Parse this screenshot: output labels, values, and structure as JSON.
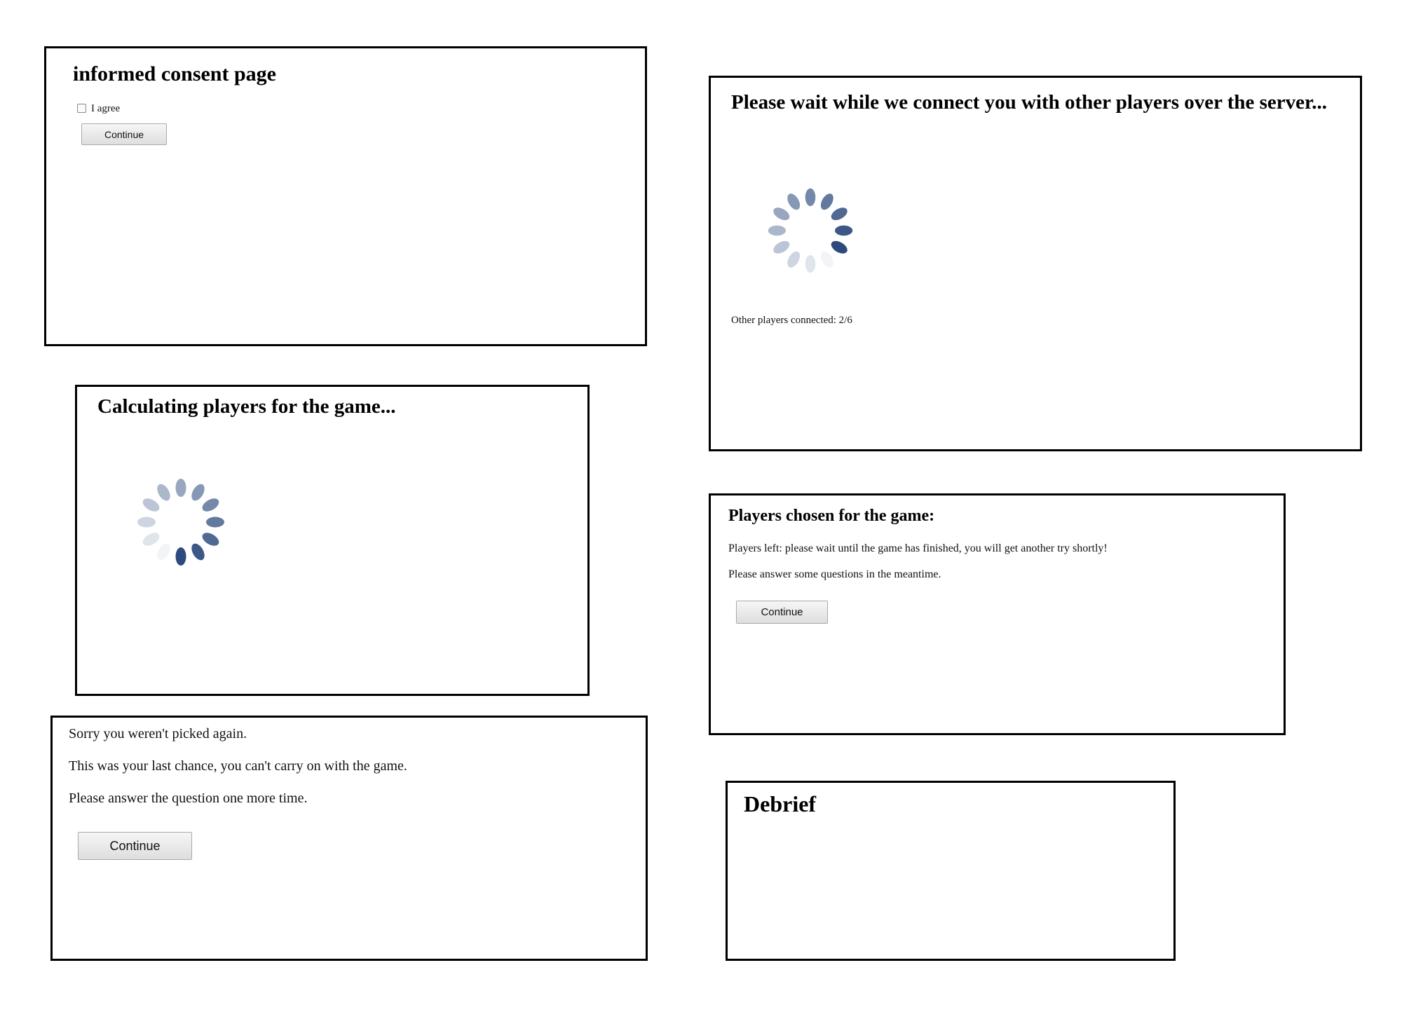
{
  "consent": {
    "title": "informed consent page",
    "checkbox_label": "I agree",
    "checkbox_checked": false,
    "continue_label": "Continue"
  },
  "calculating": {
    "title": "Calculating players for the game..."
  },
  "not_picked": {
    "line1": "Sorry you weren't picked again.",
    "line2": "This was your last chance, you can't carry on with the game.",
    "line3": "Please answer the question one more time.",
    "continue_label": "Continue"
  },
  "waiting": {
    "title": "Please wait while we connect you with other players over the server...",
    "status": "Other players connected: 2/6"
  },
  "chosen": {
    "title": "Players chosen for the game:",
    "line1": "Players left: please wait until the game has finished, you will get another try shortly!",
    "line2": "Please answer some questions in the meantime.",
    "continue_label": "Continue"
  },
  "debrief": {
    "title": "Debrief"
  },
  "colors": {
    "border": "#000000",
    "spinner": "#2c4a7c"
  },
  "icons": {
    "spinner": "loading-spinner-icon"
  }
}
